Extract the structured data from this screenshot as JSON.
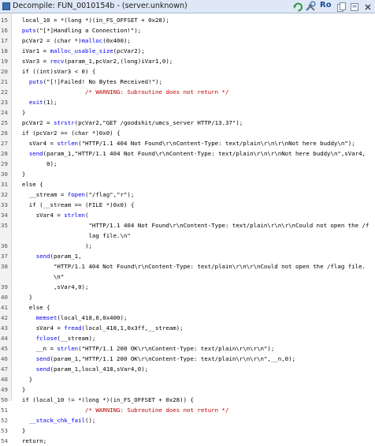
{
  "window": {
    "title": "Decompile: FUN_0010154b - (server.unknown)",
    "ro_label": "Ro"
  },
  "lines": [
    {
      "n": "15",
      "t": "  local_10 = *(long *)(in_FS_OFFSET + 0x28);"
    },
    {
      "n": "16",
      "t": "  puts(\"[*]Handling a Connection!\");"
    },
    {
      "n": "17",
      "t": "  pcVar2 = (char *)malloc(0x400);"
    },
    {
      "n": "18",
      "t": "  iVar1 = malloc_usable_size(pcVar2);"
    },
    {
      "n": "19",
      "t": "  sVar3 = recv(param_1,pcVar2,(long)iVar1,0);"
    },
    {
      "n": "20",
      "t": "  if ((int)sVar3 < 0) {"
    },
    {
      "n": "21",
      "t": "    puts(\"[!]Failed! No Bytes Received!\");"
    },
    {
      "n": "22",
      "t": "                    /* WARNING: Subroutine does not return */"
    },
    {
      "n": "23",
      "t": "    exit(1);"
    },
    {
      "n": "24",
      "t": "  }"
    },
    {
      "n": "25",
      "t": "  pcVar2 = strstr(pcVar2,\"GET /goodshit/umcs_server HTTP/13.37\");"
    },
    {
      "n": "26",
      "t": "  if (pcVar2 == (char *)0x0) {"
    },
    {
      "n": "27",
      "t": "    sVar4 = strlen(\"HTTP/1.1 404 Not Found\\r\\nContent-Type: text/plain\\r\\n\\r\\nNot here buddy\\n\");"
    },
    {
      "n": "28",
      "t": "    send(param_1,\"HTTP/1.1 404 Not Found\\r\\nContent-Type: text/plain\\r\\n\\r\\nNot here buddy\\n\",sVar4,"
    },
    {
      "n": "29",
      "t": "         0);"
    },
    {
      "n": "30",
      "t": "  }"
    },
    {
      "n": "31",
      "t": "  else {"
    },
    {
      "n": "32",
      "t": "    __stream = fopen(\"/flag\",\"r\");"
    },
    {
      "n": "33",
      "t": "    if (__stream == (FILE *)0x0) {"
    },
    {
      "n": "34",
      "t": "      sVar4 = strlen("
    },
    {
      "n": "35",
      "t": "                     \"HTTP/1.1 404 Not Found\\r\\nContent-Type: text/plain\\r\\n\\r\\nCould not open the /f"
    },
    {
      "n": "",
      "t": "                     lag file.\\n\""
    },
    {
      "n": "36",
      "t": "                    );"
    },
    {
      "n": "37",
      "t": "      send(param_1,"
    },
    {
      "n": "38",
      "t": "           \"HTTP/1.1 404 Not Found\\r\\nContent-Type: text/plain\\r\\n\\r\\nCould not open the /flag file."
    },
    {
      "n": "",
      "t": "           \\n\""
    },
    {
      "n": "39",
      "t": "           ,sVar4,0);"
    },
    {
      "n": "40",
      "t": "    }"
    },
    {
      "n": "41",
      "t": "    else {"
    },
    {
      "n": "42",
      "t": "      memset(local_418,0,0x400);"
    },
    {
      "n": "43",
      "t": "      sVar4 = fread(local_418,1,0x3ff,__stream);"
    },
    {
      "n": "44",
      "t": "      fclose(__stream);"
    },
    {
      "n": "45",
      "t": "      __n = strlen(\"HTTP/1.1 200 OK\\r\\nContent-Type: text/plain\\r\\n\\r\\n\");"
    },
    {
      "n": "46",
      "t": "      send(param_1,\"HTTP/1.1 200 OK\\r\\nContent-Type: text/plain\\r\\n\\r\\n\",__n,0);"
    },
    {
      "n": "47",
      "t": "      send(param_1,local_418,sVar4,0);"
    },
    {
      "n": "48",
      "t": "    }"
    },
    {
      "n": "49",
      "t": "  }"
    },
    {
      "n": "50",
      "t": "  if (local_10 != *(long *)(in_FS_OFFSET + 0x28)) {"
    },
    {
      "n": "51",
      "t": "                    /* WARNING: Subroutine does not return */"
    },
    {
      "n": "52",
      "t": "    __stack_chk_fail();"
    },
    {
      "n": "53",
      "t": "  }"
    },
    {
      "n": "54",
      "t": "  return;"
    }
  ],
  "highlight": {
    "functions": [
      "strlen",
      "send",
      "fopen",
      "memset",
      "fread",
      "fclose",
      "strstr",
      "recv",
      "malloc_usable_size",
      "malloc",
      "puts",
      "exit",
      "__stack_chk_fail"
    ],
    "colors": {
      "function": "#0000ee",
      "comment": "#c00000",
      "text": "#000000",
      "line_number": "#555555"
    }
  }
}
